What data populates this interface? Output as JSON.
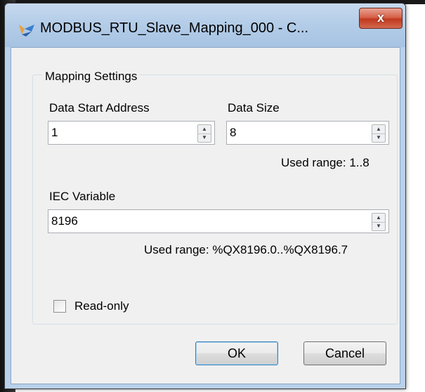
{
  "window": {
    "title": "MODBUS_RTU_Slave_Mapping_000 - C...",
    "close_label": "x"
  },
  "mapping": {
    "group_title": "Mapping Settings",
    "start_address": {
      "label": "Data Start Address",
      "value": "1"
    },
    "data_size": {
      "label": "Data Size",
      "value": "8",
      "used_range": "Used range: 1..8"
    },
    "iec_variable": {
      "label": "IEC Variable",
      "value": "8196",
      "used_range": "Used range: %QX8196.0..%QX8196.7"
    },
    "read_only": {
      "label": "Read-only",
      "checked": false
    }
  },
  "buttons": {
    "ok": "OK",
    "cancel": "Cancel"
  },
  "icons": {
    "spin_up": "▲",
    "spin_down": "▼"
  }
}
